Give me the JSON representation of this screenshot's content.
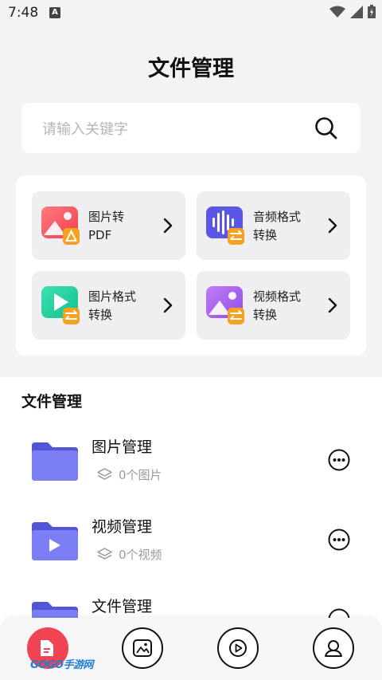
{
  "status": {
    "time": "7:48",
    "notification_glyph": "A"
  },
  "header": {
    "title": "文件管理"
  },
  "search": {
    "placeholder": "请输入关键字"
  },
  "tools": [
    {
      "label_line1": "图片转",
      "label_line2": "PDF",
      "icon": "image-to-pdf-icon",
      "color": "#f0525c"
    },
    {
      "label_line1": "音频格式",
      "label_line2": "转换",
      "icon": "audio-format-icon",
      "color": "#5a56e8"
    },
    {
      "label_line1": "图片格式",
      "label_line2": "转换",
      "icon": "image-format-icon",
      "color": "#1fcf9a"
    },
    {
      "label_line1": "视频格式",
      "label_line2": "转换",
      "icon": "video-format-icon",
      "color": "#a963f0"
    }
  ],
  "section": {
    "title": "文件管理",
    "rows": [
      {
        "name": "图片管理",
        "count": "0个图片"
      },
      {
        "name": "视频管理",
        "count": "0个视频"
      },
      {
        "name": "文件管理",
        "count": ""
      }
    ]
  },
  "watermark": "GOGO手游网",
  "colors": {
    "accent_red": "#f04452",
    "folder_purple": "#6a6cf0",
    "badge_orange": "#f7a21f"
  }
}
